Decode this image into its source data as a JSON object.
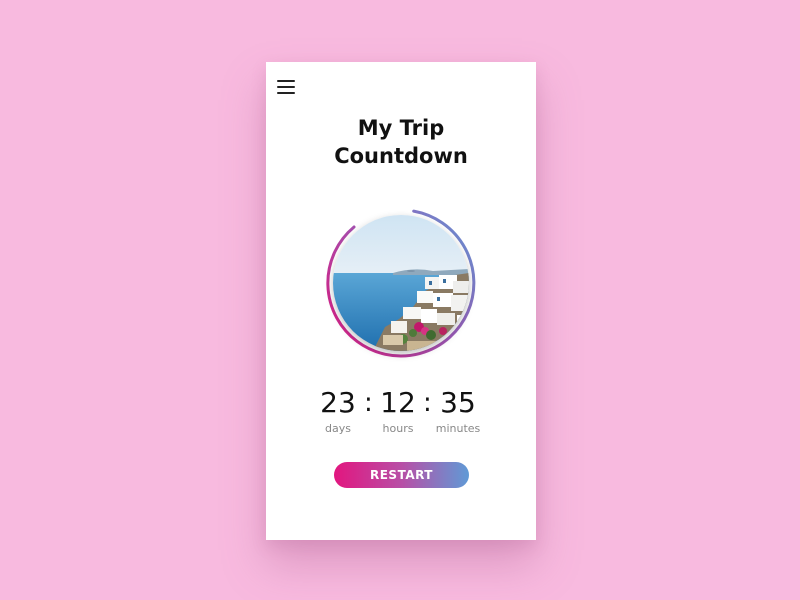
{
  "header": {
    "menu_icon": "hamburger-menu-icon",
    "title_line1": "My Trip",
    "title_line2": "Countdown"
  },
  "hero": {
    "image_subject": "Santorini white houses above the sea",
    "ring_colors": [
      "#e2167f",
      "#9b59b6",
      "#5f9ad6"
    ]
  },
  "countdown": {
    "days_value": "23",
    "days_label": "days",
    "hours_value": "12",
    "hours_label": "hours",
    "minutes_value": "35",
    "minutes_label": "minutes",
    "separator": ":"
  },
  "actions": {
    "restart_label": "RESTART"
  },
  "colors": {
    "background": "#f8badf",
    "card": "#ffffff",
    "accent_start": "#e2167f",
    "accent_end": "#5f9ad6"
  }
}
